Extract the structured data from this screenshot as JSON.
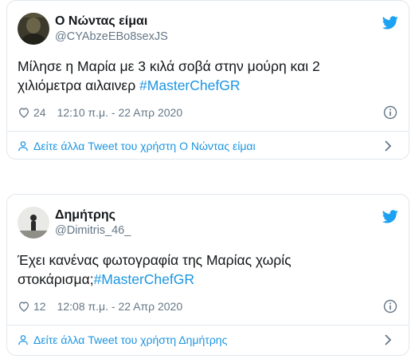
{
  "tweets": [
    {
      "name": "Ο Νώντας είμαι",
      "handle": "@CYAbzeEBo8sexJS",
      "text": "Μίλησε η Μαρία με 3 κιλά σοβά στην μούρη και 2 χιλιόμετρα αιλαινερ ",
      "hashtag": "#MasterChefGR",
      "likes": "24",
      "timestamp": "12:10 π.μ. - 22 Απρ 2020",
      "profile_link": "Δείτε άλλα Tweet του χρήστη Ο Νώντας είμαι"
    },
    {
      "name": "Δημήτρης",
      "handle": "@Dimitris_46_",
      "text": "Έχει κανένας φωτογραφία της Μαρίας χωρίς στοκάρισμα;",
      "hashtag": "#MasterChefGR",
      "likes": "12",
      "timestamp": "12:08 π.μ. - 22 Απρ 2020",
      "profile_link": "Δείτε άλλα Tweet του χρήστη Δημήτρης"
    }
  ],
  "icons": {
    "brand": "twitter-bird-icon",
    "like": "heart-icon",
    "info": "info-icon",
    "profile": "person-icon",
    "chevron": "chevron-right-icon"
  },
  "colors": {
    "accent": "#1b95e0",
    "text": "#14171a",
    "muted": "#657786",
    "border": "#e1e8ed"
  }
}
